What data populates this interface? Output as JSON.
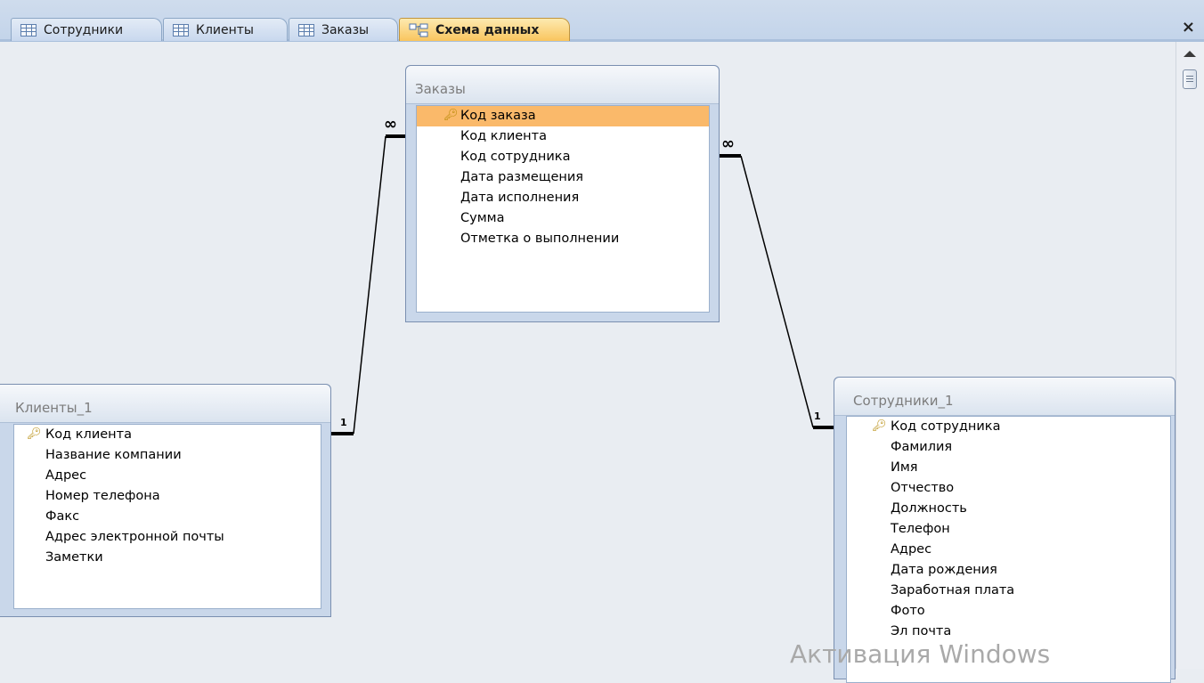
{
  "tabs": [
    {
      "label": "Сотрудники",
      "icon": "table-icon",
      "active": false
    },
    {
      "label": "Клиенты",
      "icon": "table-icon",
      "active": false
    },
    {
      "label": "Заказы",
      "icon": "table-icon",
      "active": false
    },
    {
      "label": "Схема данных",
      "icon": "relationships-icon",
      "active": true
    }
  ],
  "close_label": "×",
  "tables": {
    "orders": {
      "title": "Заказы",
      "fields": [
        "Код заказа",
        "Код клиента",
        "Код сотрудника",
        "Дата размещения",
        "Дата исполнения",
        "Сумма",
        "Отметка о выполнении"
      ],
      "primary_key": "Код заказа",
      "selected_field": "Код заказа"
    },
    "clients": {
      "title": "Клиенты_1",
      "fields": [
        "Код клиента",
        "Название компании",
        "Адрес",
        "Номер телефона",
        "Факс",
        "Адрес электронной почты",
        "Заметки"
      ],
      "primary_key": "Код клиента"
    },
    "employees": {
      "title": "Сотрудники_1",
      "fields": [
        "Код сотрудника",
        "Фамилия",
        "Имя",
        "Отчество",
        "Должность",
        "Телефон",
        "Адрес",
        "Дата рождения",
        "Заработная плата",
        "Фото",
        "Эл почта"
      ],
      "primary_key": "Код сотрудника"
    }
  },
  "relationships": [
    {
      "from": "Клиенты_1",
      "to": "Заказы",
      "one_label": "1",
      "many_label": "∞"
    },
    {
      "from": "Сотрудники_1",
      "to": "Заказы",
      "one_label": "1",
      "many_label": "∞"
    }
  ],
  "watermark": "Активация Windows",
  "colors": {
    "selected_row": "#fab96a",
    "active_tab": "#f9c55e",
    "tab_bar": "#c3d4ea",
    "canvas": "#e9edf2"
  }
}
